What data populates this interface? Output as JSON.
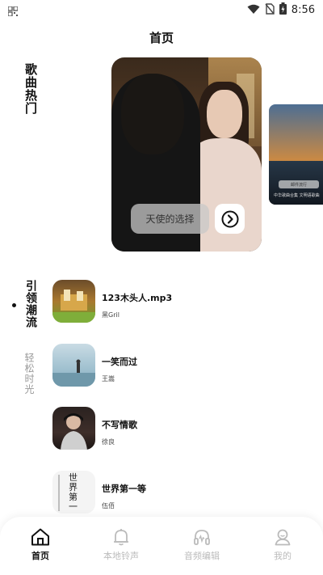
{
  "status_bar": {
    "time": "8:56"
  },
  "page": {
    "title": "首页"
  },
  "hot_section": {
    "label": "歌曲热门"
  },
  "banner": {
    "song_label": "天使的选择",
    "next_card_pill": "邮件流行",
    "next_card_caption": "中华歌曲合集 文明语歌曲"
  },
  "categories": [
    {
      "label": "引领潮流",
      "active": true
    },
    {
      "label": "轻松时光",
      "active": false
    }
  ],
  "songs": [
    {
      "title": "123木头人.mp3",
      "artist": "黑Gril",
      "cover_text": ""
    },
    {
      "title": "一笑而过",
      "artist": "王嵩",
      "cover_text": ""
    },
    {
      "title": "不写情歌",
      "artist": "徐良",
      "cover_text": ""
    },
    {
      "title": "世界第一等",
      "artist": "伍佰",
      "cover_text": "世界第一等"
    }
  ],
  "bottom_nav": [
    {
      "label": "首页",
      "icon": "home-icon",
      "active": true
    },
    {
      "label": "本地铃声",
      "icon": "bell-icon",
      "active": false
    },
    {
      "label": "音频编辑",
      "icon": "headphones-icon",
      "active": false
    },
    {
      "label": "我的",
      "icon": "profile-icon",
      "active": false
    }
  ]
}
